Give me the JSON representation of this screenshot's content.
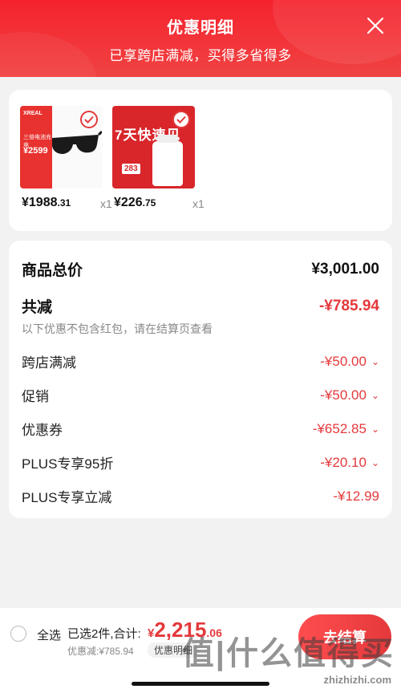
{
  "header": {
    "title": "优惠明细",
    "subtitle": "已享跨店满减，买得多省得多"
  },
  "products": [
    {
      "price_int": "¥1988",
      "price_dec": ".31",
      "qty": "x1",
      "thumb_lines": [
        "XREAL",
        "三倍电池充电",
        "¥2599"
      ]
    },
    {
      "price_int": "¥226",
      "price_dec": ".75",
      "qty": "x1",
      "thumb_headline": "7天快速见",
      "thumb_tag": "283"
    }
  ],
  "summary": {
    "total_label": "商品总价",
    "total_value": "¥3,001.00",
    "reduced_label": "共减",
    "reduced_value": "-¥785.94",
    "note": "以下优惠不包含红包，请在结算页查看",
    "items": [
      {
        "label": "跨店满减",
        "value": "-¥50.00"
      },
      {
        "label": "促销",
        "value": "-¥50.00"
      },
      {
        "label": "优惠券",
        "value": "-¥652.85"
      },
      {
        "label": "PLUS专享95折",
        "value": "-¥20.10"
      },
      {
        "label": "PLUS专享立减",
        "value": "-¥12.99"
      }
    ]
  },
  "footer": {
    "select_all": "全选",
    "selected_info": "已选2件,合计:",
    "total_currency": "¥",
    "total_int": "2,215",
    "total_dec": ".06",
    "discount_info": "优惠减:¥785.94",
    "detail_chip": "优惠明细",
    "checkout_label": "去结算",
    "watermark": "值|什么值得买",
    "watermark_url": "zhizhizhi.com"
  },
  "colors": {
    "accent": "#e4393c",
    "header": "#f5222d"
  }
}
